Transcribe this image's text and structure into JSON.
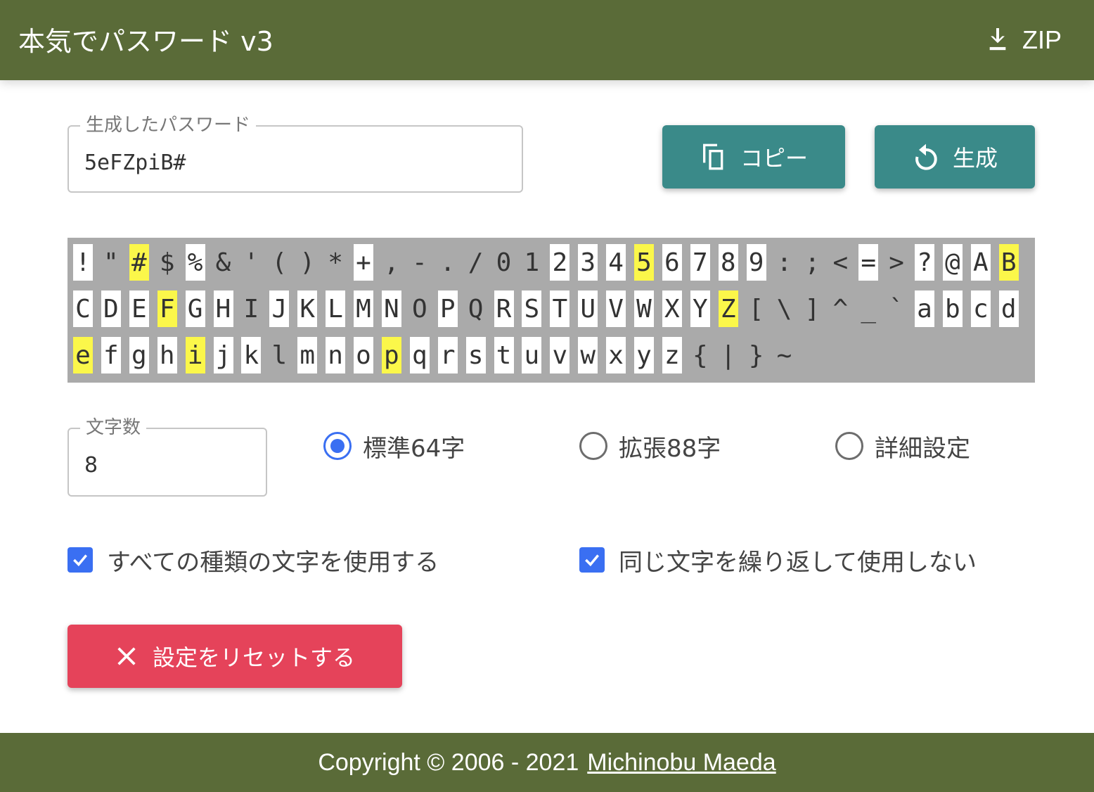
{
  "header": {
    "title": "本気でパスワード v3",
    "zip_label": "ZIP",
    "zip_icon": "download-icon"
  },
  "password_field": {
    "label": "生成したパスワード",
    "value": "5eFZpiB#"
  },
  "buttons": {
    "copy_label": "コピー",
    "copy_icon": "copy-icon",
    "generate_label": "生成",
    "generate_icon": "refresh-icon",
    "reset_label": "設定をリセットする",
    "reset_icon": "close-icon"
  },
  "char_rows": [
    [
      "!",
      "\"",
      "#",
      "$",
      "%",
      "&",
      "'",
      "(",
      ")",
      "*",
      "+",
      ",",
      "-",
      ".",
      "/",
      "0",
      "1",
      "2",
      "3",
      "4",
      "5",
      "6",
      "7",
      "8",
      "9",
      ":",
      ";",
      "<",
      "=",
      ">",
      "?",
      "@",
      "A",
      "B"
    ],
    [
      "C",
      "D",
      "E",
      "F",
      "G",
      "H",
      "I",
      "J",
      "K",
      "L",
      "M",
      "N",
      "O",
      "P",
      "Q",
      "R",
      "S",
      "T",
      "U",
      "V",
      "W",
      "X",
      "Y",
      "Z",
      "[",
      "\\",
      "]",
      "^",
      "_",
      "`",
      "a",
      "b",
      "c",
      "d"
    ],
    [
      "e",
      "f",
      "g",
      "h",
      "i",
      "j",
      "k",
      "l",
      "m",
      "n",
      "o",
      "p",
      "q",
      "r",
      "s",
      "t",
      "u",
      "v",
      "w",
      "x",
      "y",
      "z",
      "{",
      "|",
      "}",
      "~"
    ]
  ],
  "char_included": "!#%+23456789=?@ABCDEFGHJKLMNPRSTUVWXYZabcdefghijkmnopqrstuvwxyz",
  "char_used": "#5BFZeip",
  "length_field": {
    "label": "文字数",
    "value": "8"
  },
  "charset_options": [
    {
      "label": "標準64字",
      "checked": true
    },
    {
      "label": "拡張88字",
      "checked": false
    },
    {
      "label": "詳細設定",
      "checked": false
    }
  ],
  "options": {
    "use_all_types_label": "すべての種類の文字を使用する",
    "use_all_types_checked": true,
    "no_repeat_label": "同じ文字を繰り返して使用しない",
    "no_repeat_checked": true
  },
  "footer": {
    "copyright": "Copyright © 2006 - 2021",
    "author": "Michinobu Maeda"
  },
  "colors": {
    "header_bg": "#5a6b38",
    "primary_button": "#3a8a89",
    "reset_button": "#e5435a",
    "accent": "#3a6ff2",
    "used_char": "#fbf74a",
    "grid_bg": "#aaaaaa"
  }
}
